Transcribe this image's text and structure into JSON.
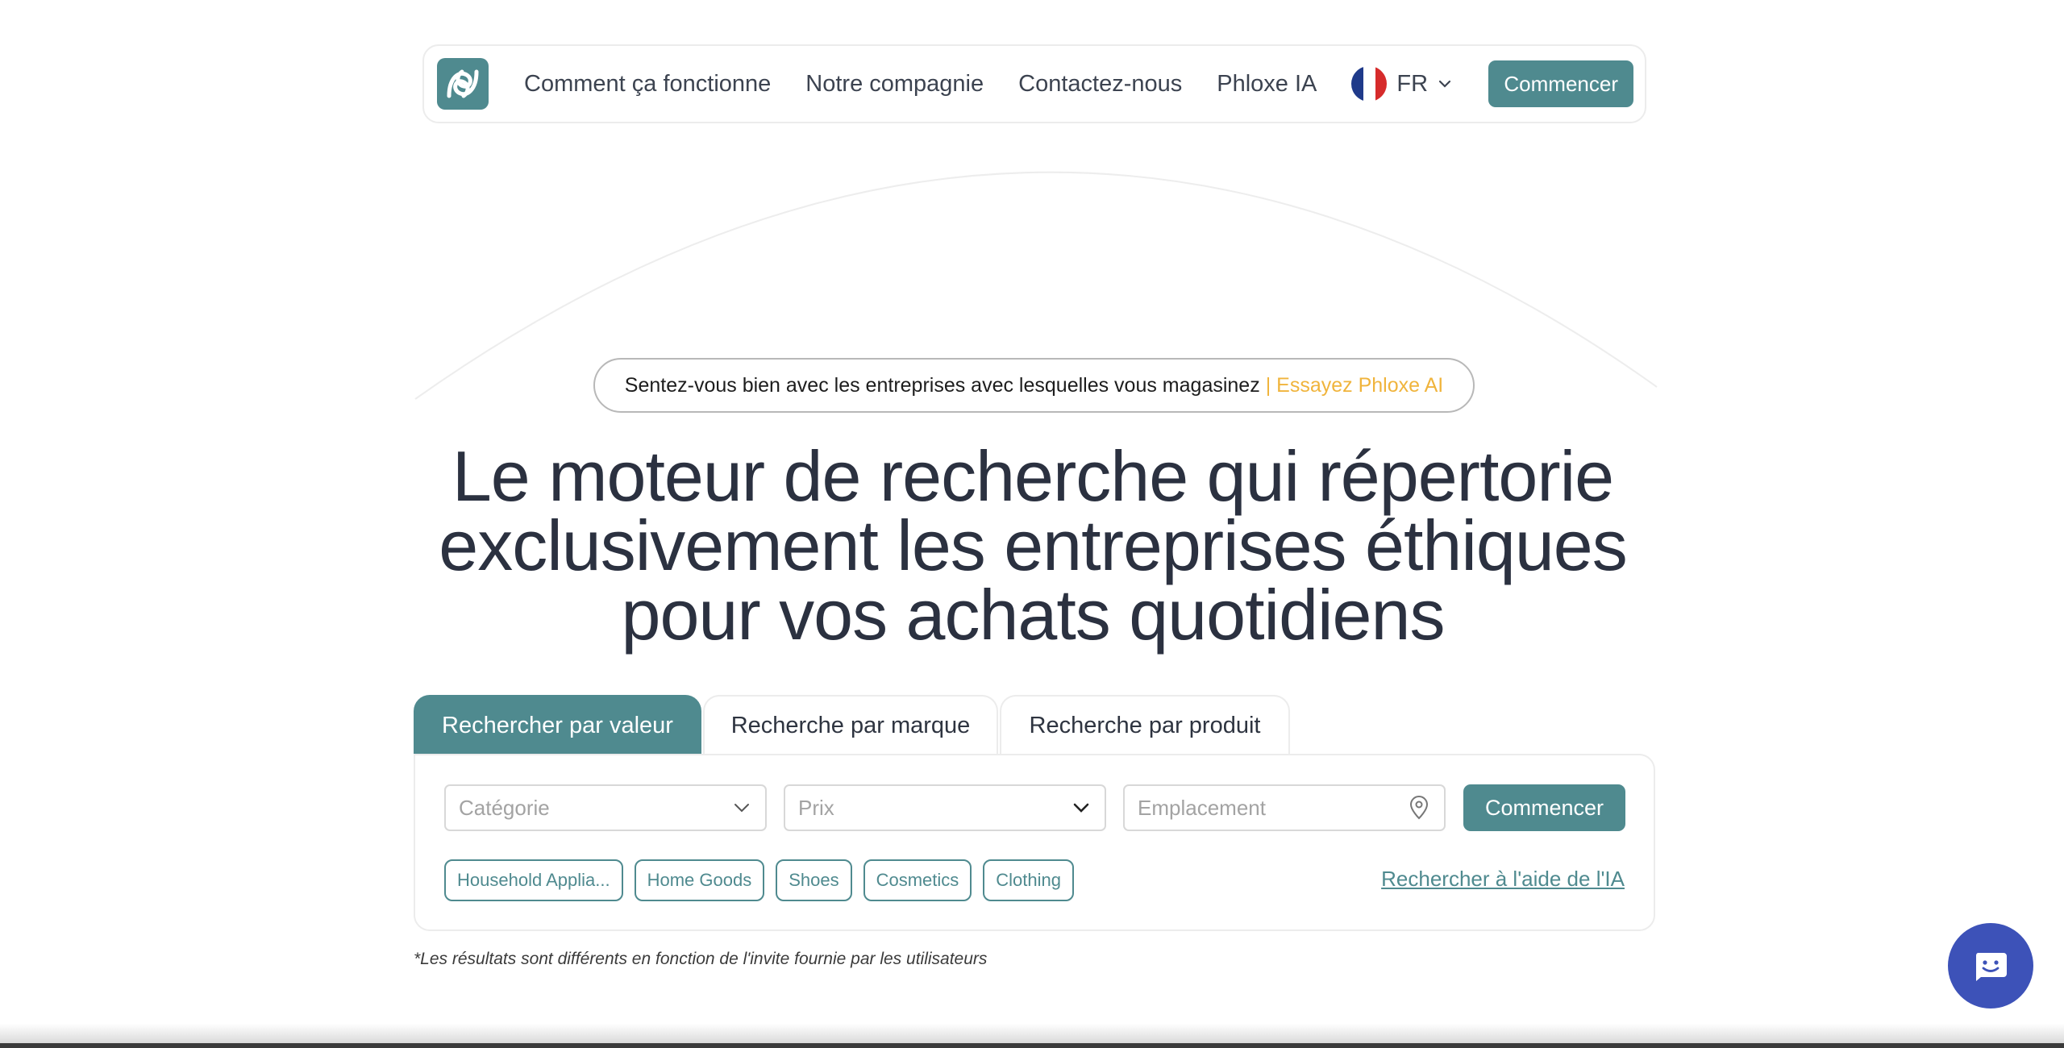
{
  "brand": {
    "logo_icon": "phloxe-logo-icon",
    "accent": "#4f8a8f"
  },
  "nav": {
    "links": [
      "Comment ça fonctionne",
      "Notre compagnie",
      "Contactez-nous",
      "Phloxe IA"
    ],
    "language": "FR",
    "cta_label": "Commencer"
  },
  "hero": {
    "pill_text": "Sentez-vous bien avec les entreprises avec lesquelles vous magasinez",
    "pill_accent": "| Essayez Phloxe AI",
    "headline_lines": [
      "Le moteur de recherche qui répertorie",
      "exclusivement les entreprises éthiques",
      "pour vos achats quotidiens"
    ]
  },
  "tabs": [
    {
      "label": "Rechercher par valeur",
      "active": true
    },
    {
      "label": "Recherche par marque",
      "active": false
    },
    {
      "label": "Recherche par produit",
      "active": false
    }
  ],
  "search": {
    "category_placeholder": "Catégorie",
    "price_placeholder": "Prix",
    "location_placeholder": "Emplacement",
    "submit_label": "Commencer",
    "chips": [
      "Household Applia...",
      "Home Goods",
      "Shoes",
      "Cosmetics",
      "Clothing"
    ],
    "ai_link": "Rechercher à l'aide de l'IA"
  },
  "disclaimer": "*Les résultats sont différents en fonction de l'invite fournie par les utilisateurs",
  "colors": {
    "primary": "#4f8a8f",
    "accent_text": "#f0b43c",
    "chat": "#3d52b8"
  }
}
